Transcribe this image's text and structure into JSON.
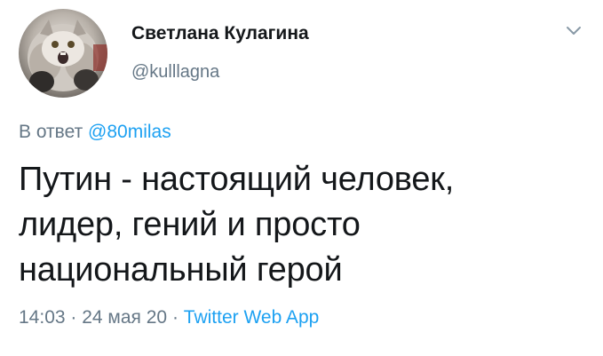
{
  "author": {
    "display_name": "Светлана Кулагина",
    "handle": "@kulllagna",
    "avatar_icon": "cat-avatar-icon"
  },
  "menu": {
    "icon": "chevron-down-icon"
  },
  "reply": {
    "prefix": "В ответ",
    "mention": "@80milas"
  },
  "tweet": {
    "text": "Путин - настоящий человек,\nлидер, гений и просто\nнациональный герой"
  },
  "meta": {
    "time": "14:03",
    "separator1": " · ",
    "date": "24 мая 20",
    "separator2": " · ",
    "source": "Twitter Web App"
  },
  "colors": {
    "link": "#1da1f2",
    "secondary_text": "#657786",
    "primary_text": "#14171a"
  }
}
